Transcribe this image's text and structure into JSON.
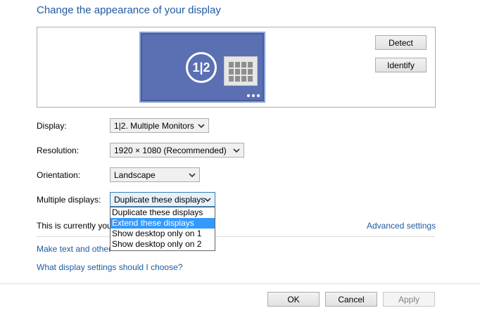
{
  "page": {
    "title": "Change the appearance of your display"
  },
  "preview": {
    "monitor_label": "1|2",
    "buttons": {
      "detect": "Detect",
      "identify": "Identify"
    }
  },
  "fields": {
    "display": {
      "label": "Display:",
      "value": "1|2. Multiple Monitors"
    },
    "resolution": {
      "label": "Resolution:",
      "value": "1920 × 1080 (Recommended)"
    },
    "orientation": {
      "label": "Orientation:",
      "value": "Landscape"
    },
    "multiple_displays": {
      "label": "Multiple displays:",
      "value": "Duplicate these displays",
      "options": [
        "Duplicate these displays",
        "Extend these displays",
        "Show desktop only on 1",
        "Show desktop only on 2"
      ],
      "highlighted_index": 1
    }
  },
  "status": {
    "text": "This is currently you",
    "advanced_link": "Advanced settings"
  },
  "links": {
    "make_text": "Make text and other",
    "which_settings": "What display settings should I choose?"
  },
  "footer": {
    "ok": "OK",
    "cancel": "Cancel",
    "apply": "Apply"
  },
  "colors": {
    "link": "#1e5aa0",
    "selection": "#3399ff",
    "monitor": "#5b6fb3"
  }
}
